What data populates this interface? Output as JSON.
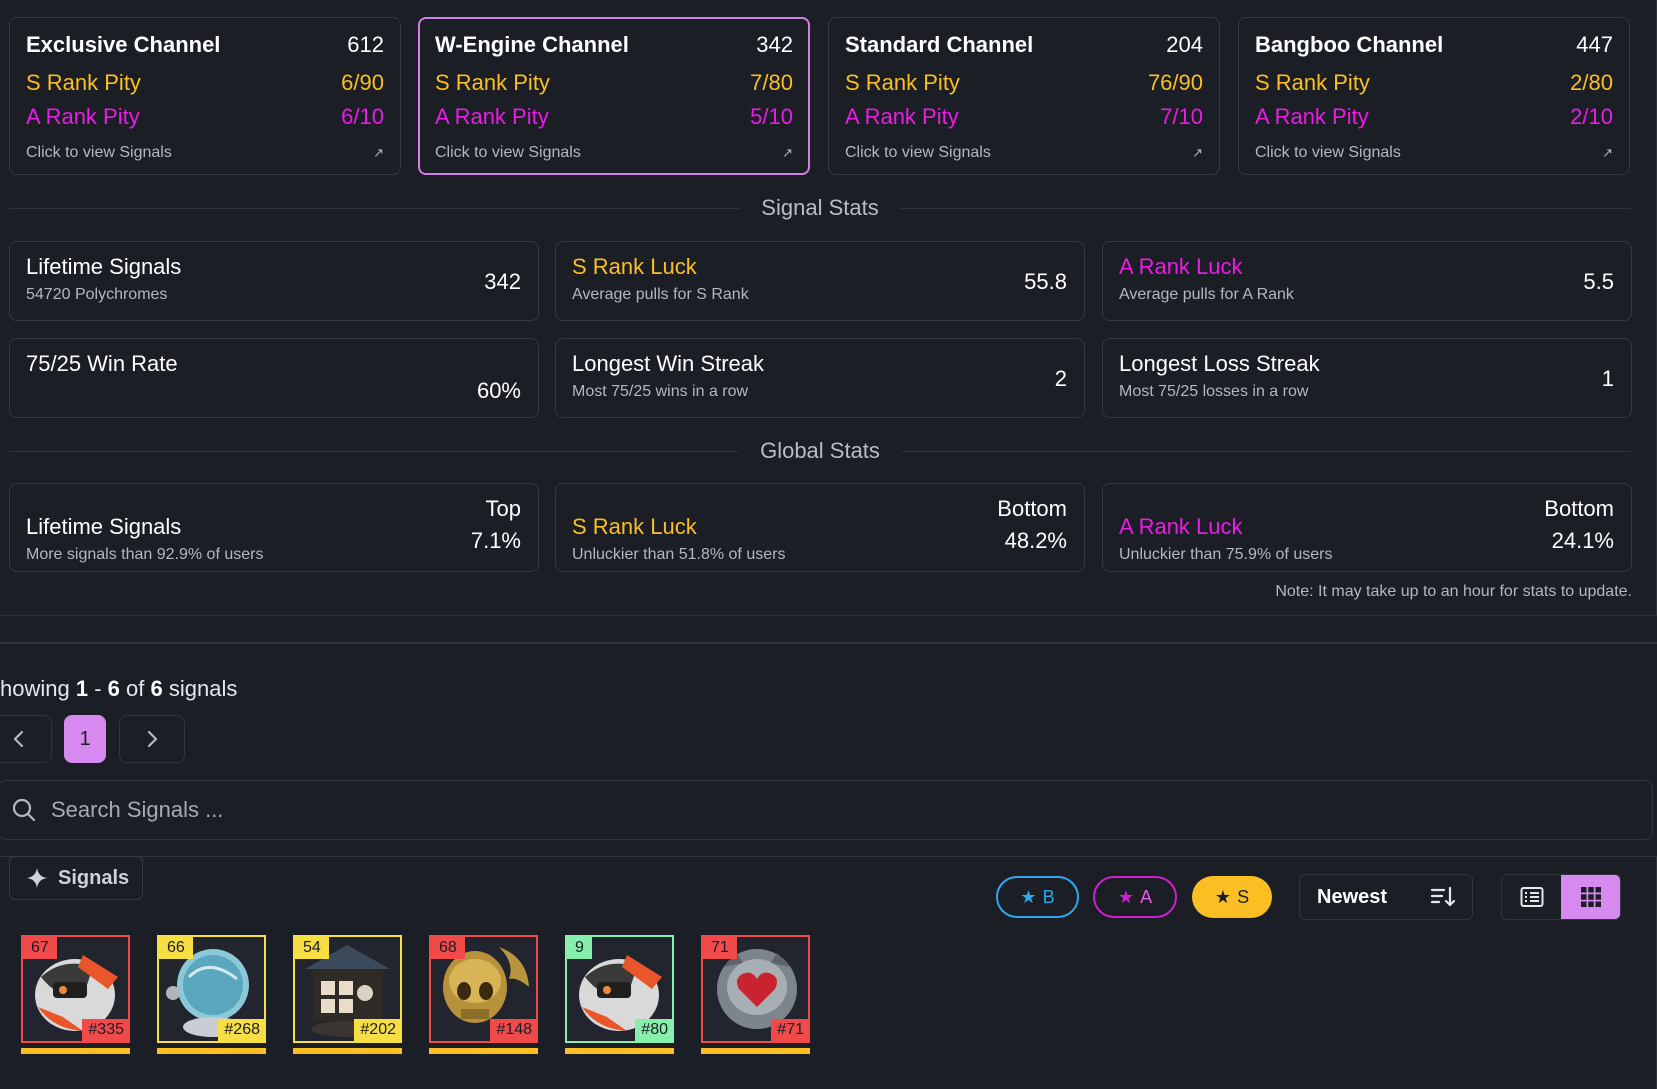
{
  "channels": [
    {
      "title": "Exclusive Channel",
      "count": "612",
      "s_label": "S Rank Pity",
      "s_value": "6/90",
      "a_label": "A Rank Pity",
      "a_value": "6/10",
      "footer": "Click to view Signals"
    },
    {
      "title": "W-Engine Channel",
      "count": "342",
      "s_label": "S Rank Pity",
      "s_value": "7/80",
      "a_label": "A Rank Pity",
      "a_value": "5/10",
      "footer": "Click to view Signals"
    },
    {
      "title": "Standard Channel",
      "count": "204",
      "s_label": "S Rank Pity",
      "s_value": "76/90",
      "a_label": "A Rank Pity",
      "a_value": "7/10",
      "footer": "Click to view Signals"
    },
    {
      "title": "Bangboo Channel",
      "count": "447",
      "s_label": "S Rank Pity",
      "s_value": "2/80",
      "a_label": "A Rank Pity",
      "a_value": "2/10",
      "footer": "Click to view Signals"
    }
  ],
  "signal_stats": {
    "heading": "Signal Stats",
    "items": [
      {
        "label": "Lifetime Signals",
        "sub": "54720 Polychromes",
        "value": "342"
      },
      {
        "label": "S Rank Luck",
        "sub": "Average pulls for S Rank",
        "value": "55.8"
      },
      {
        "label": "A Rank Luck",
        "sub": "Average pulls for A Rank",
        "value": "5.5"
      },
      {
        "label": "75/25 Win Rate",
        "sub": "",
        "value": "60%"
      },
      {
        "label": "Longest Win Streak",
        "sub": "Most 75/25 wins in a row",
        "value": "2"
      },
      {
        "label": "Longest Loss Streak",
        "sub": "Most 75/25 losses in a row",
        "value": "1"
      }
    ]
  },
  "global_stats": {
    "heading": "Global Stats",
    "items": [
      {
        "label": "Lifetime Signals",
        "sub": "More signals than 92.9% of users",
        "rank": "Top",
        "value": "7.1%"
      },
      {
        "label": "S Rank Luck",
        "sub": "Unluckier than 51.8% of users",
        "rank": "Bottom",
        "value": "48.2%"
      },
      {
        "label": "A Rank Luck",
        "sub": "Unluckier than 75.9% of users",
        "rank": "Bottom",
        "value": "24.1%"
      }
    ],
    "note": "Note: It may take up to an hour for stats to update."
  },
  "pagination": {
    "prefix": "howing",
    "from": "1",
    "sep": "-",
    "to": "6",
    "of": "of",
    "total": "6",
    "suffix": "signals",
    "current_page": "1"
  },
  "search": {
    "placeholder": "Search Signals ..."
  },
  "toolbar": {
    "tab_label": "Signals",
    "filter_b": "B",
    "filter_a": "A",
    "filter_s": "S",
    "sort_label": "Newest"
  },
  "signals": [
    {
      "pity": "67",
      "number": "#335",
      "rank_color": "red",
      "item": "bangboo-white-orange"
    },
    {
      "pity": "66",
      "number": "#268",
      "rank_color": "yellow",
      "item": "bangboo-blue-globe"
    },
    {
      "pity": "54",
      "number": "#202",
      "rank_color": "yellow",
      "item": "bangboo-house"
    },
    {
      "pity": "68",
      "number": "#148",
      "rank_color": "red",
      "item": "bangboo-gold-skull"
    },
    {
      "pity": "9",
      "number": "#80",
      "rank_color": "green",
      "item": "bangboo-white-orange"
    },
    {
      "pity": "71",
      "number": "#71",
      "rank_color": "red",
      "item": "bangboo-grey-heart"
    }
  ],
  "colors": {
    "background": "#1b1e25",
    "s_rank": "#fbbf24",
    "a_rank": "#ea1ce6",
    "b_rank": "#2da8f0",
    "accent": "#d68aef"
  }
}
